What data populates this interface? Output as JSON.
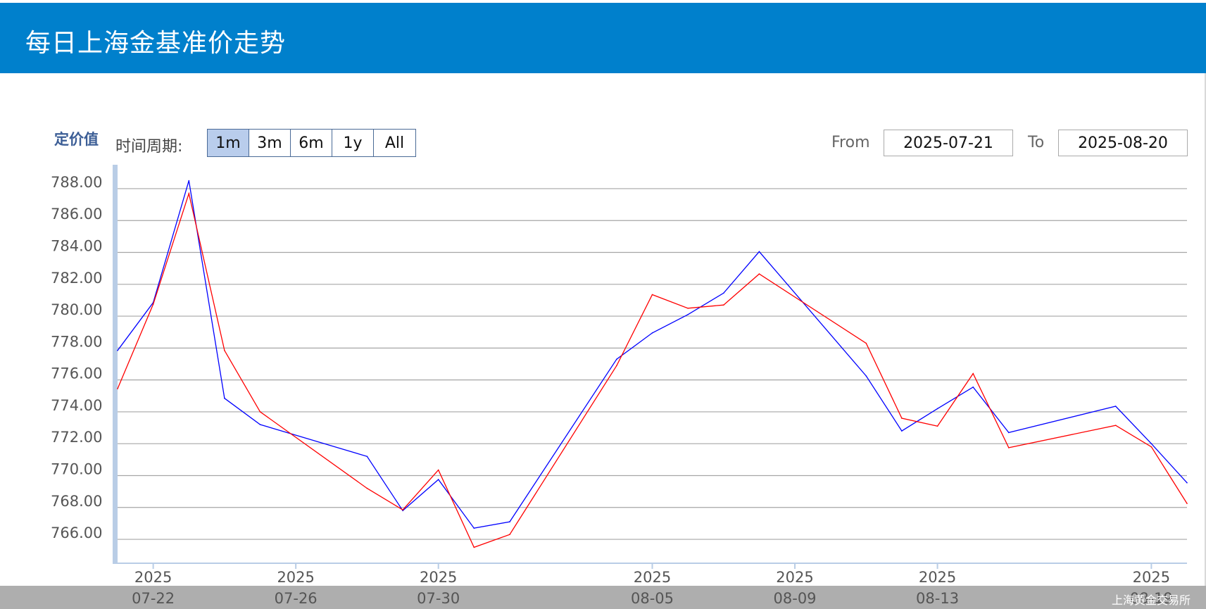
{
  "header": {
    "title": "每日上海金基准价走势"
  },
  "toolbar": {
    "value_label": "定价值",
    "period_label": "时间周期:",
    "periods": [
      "1m",
      "3m",
      "6m",
      "1y",
      "All"
    ],
    "active_period": "1m",
    "from_label": "From",
    "from_value": "2025-07-21",
    "to_label": "To",
    "to_value": "2025-08-20"
  },
  "footer": {
    "watermark": "上海黄金交易所"
  },
  "colors": {
    "header": "#0080cc",
    "series_blue": "#0000ff",
    "series_red": "#ff0000"
  },
  "chart_data": {
    "type": "line",
    "ylim": [
      764.5,
      789.5
    ],
    "yticks": [
      "788.00",
      "786.00",
      "784.00",
      "782.00",
      "780.00",
      "778.00",
      "776.00",
      "774.00",
      "772.00",
      "770.00",
      "768.00",
      "766.00"
    ],
    "xticks": [
      {
        "year": "2025",
        "date": "07-22"
      },
      {
        "year": "2025",
        "date": "07-26"
      },
      {
        "year": "2025",
        "date": "07-30"
      },
      {
        "year": "2025",
        "date": "08-05"
      },
      {
        "year": "2025",
        "date": "08-09"
      },
      {
        "year": "2025",
        "date": "08-13"
      },
      {
        "year": "2025",
        "date": "08-19"
      }
    ],
    "x": [
      "2025-07-21",
      "2025-07-22",
      "2025-07-23",
      "2025-07-24",
      "2025-07-25",
      "2025-07-28",
      "2025-07-29",
      "2025-07-30",
      "2025-07-31",
      "2025-08-01",
      "2025-08-04",
      "2025-08-05",
      "2025-08-06",
      "2025-08-07",
      "2025-08-08",
      "2025-08-11",
      "2025-08-12",
      "2025-08-13",
      "2025-08-14",
      "2025-08-15",
      "2025-08-18",
      "2025-08-19",
      "2025-08-20"
    ],
    "series": [
      {
        "color": "#0000ff",
        "values": [
          777.85,
          780.85,
          788.5,
          774.85,
          773.2,
          771.2,
          767.8,
          769.75,
          766.7,
          767.1,
          777.3,
          778.95,
          780.1,
          781.45,
          784.05,
          776.25,
          772.8,
          774.2,
          775.55,
          772.7,
          774.35,
          772.0,
          769.55
        ]
      },
      {
        "color": "#ff0000",
        "values": [
          775.45,
          780.75,
          787.7,
          777.85,
          774.0,
          769.2,
          767.85,
          770.35,
          765.5,
          766.3,
          776.9,
          781.35,
          780.5,
          780.7,
          782.65,
          778.3,
          773.6,
          773.1,
          776.4,
          771.75,
          773.15,
          771.8,
          768.25
        ]
      }
    ]
  }
}
